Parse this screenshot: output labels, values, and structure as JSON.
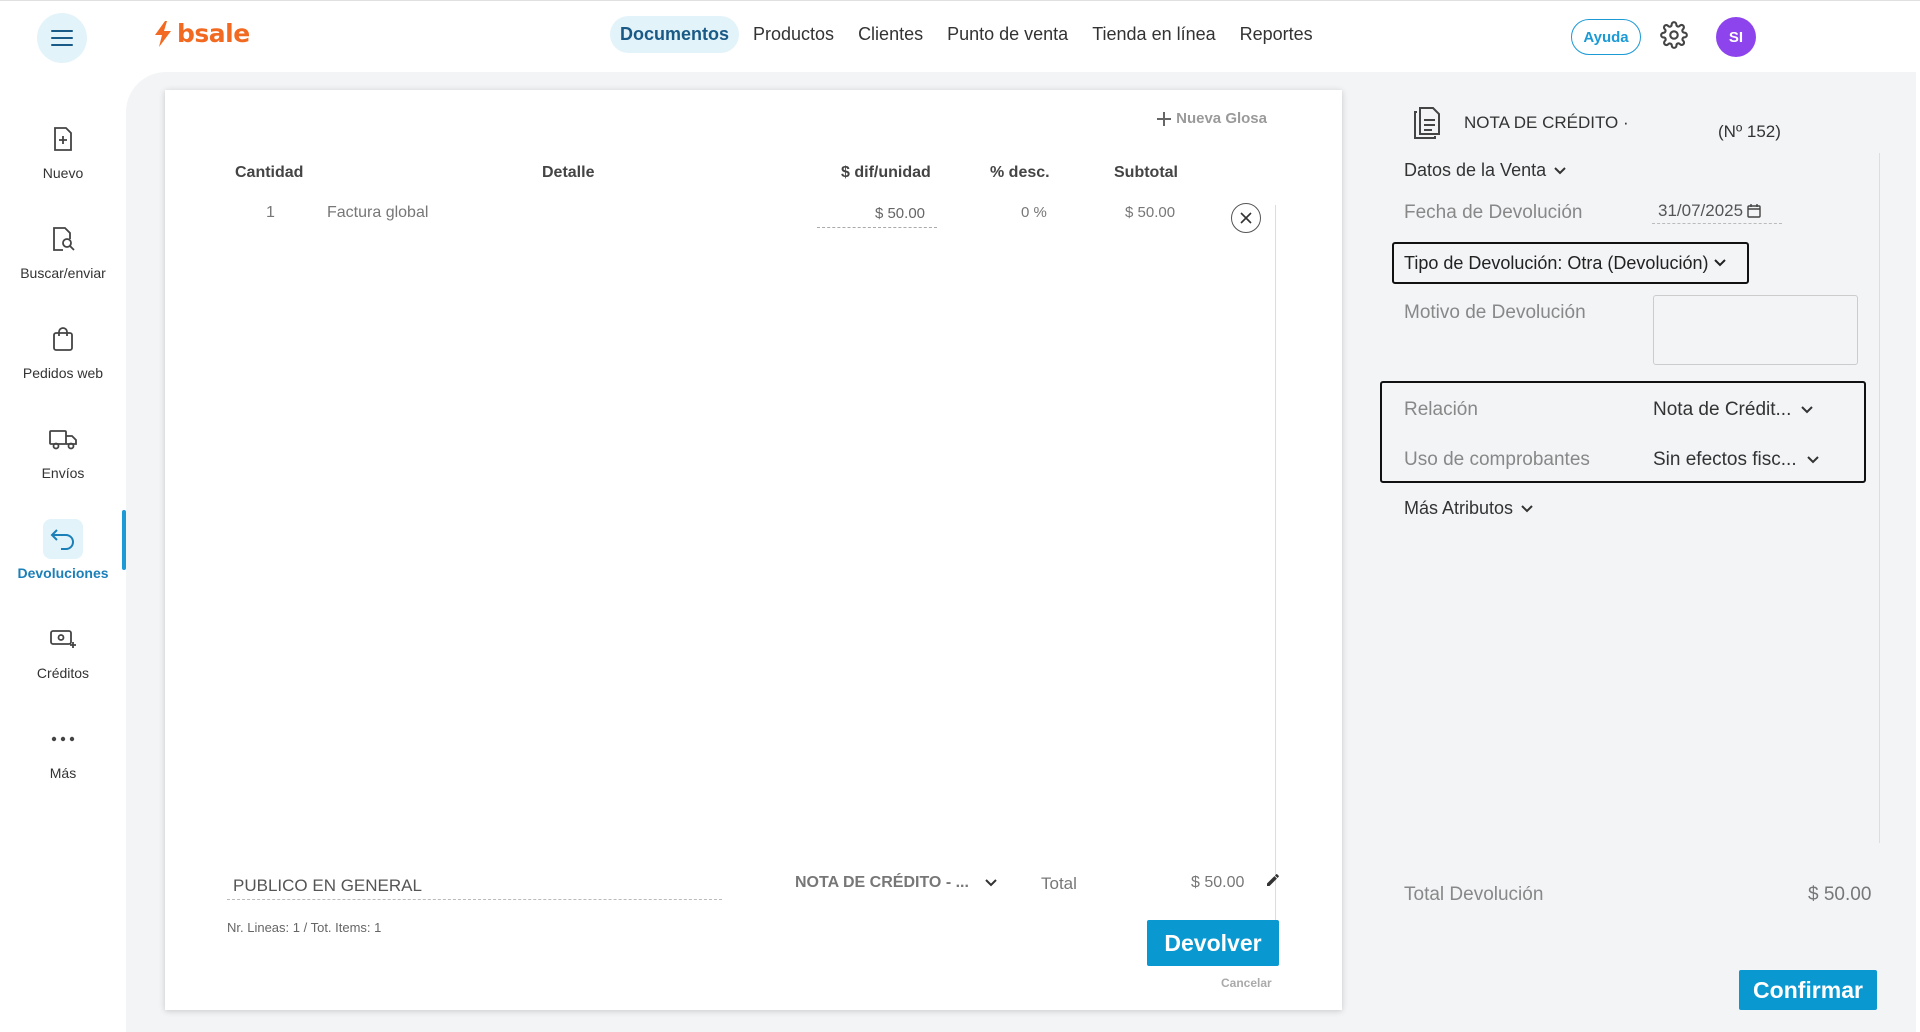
{
  "brand": {
    "name": "bsale",
    "color": "#f26a21"
  },
  "accent_color": "#0a98d1",
  "nav": [
    {
      "label": "Documentos",
      "active": true
    },
    {
      "label": "Productos"
    },
    {
      "label": "Clientes"
    },
    {
      "label": "Punto de venta"
    },
    {
      "label": "Tienda en línea"
    },
    {
      "label": "Reportes"
    }
  ],
  "header": {
    "help_label": "Ayuda",
    "avatar_initials": "SI"
  },
  "sidebar": {
    "items": [
      {
        "label": "Nuevo",
        "icon": "file-plus-icon"
      },
      {
        "label": "Buscar/enviar",
        "icon": "file-search-icon"
      },
      {
        "label": "Pedidos web",
        "icon": "shopping-bag-icon"
      },
      {
        "label": "Envíos",
        "icon": "truck-icon"
      },
      {
        "label": "Devoluciones",
        "icon": "return-arrow-icon",
        "active": true
      },
      {
        "label": "Créditos",
        "icon": "cash-plus-icon"
      },
      {
        "label": "Más",
        "icon": "more-dots-icon"
      }
    ]
  },
  "document": {
    "new_gloss_label": "Nueva Glosa",
    "columns": [
      "Cantidad",
      "Detalle",
      "$ dif/unidad",
      "% desc.",
      "Subtotal"
    ],
    "rows": [
      {
        "quantity": "1",
        "detail": "Factura global",
        "unit_price": "$ 50.00",
        "discount": "0 %",
        "subtotal": "$ 50.00"
      }
    ],
    "client": "PUBLICO EN GENERAL",
    "doc_type": "NOTA DE CRÉDITO - ...",
    "total_label": "Total",
    "total_value": "$ 50.00",
    "lines_info": "Nr. Lineas: 1 / Tot. Items: 1",
    "submit_label": "Devolver",
    "cancel_label": "Cancelar"
  },
  "panel": {
    "doc_title": "NOTA DE CRÉDITO ·",
    "doc_number": "(Nº 152)",
    "sale_data_label": "Datos de la Venta",
    "return_date_label": "Fecha de Devolución",
    "return_date_value": "31/07/2025",
    "return_type_label": "Tipo de Devolución: Otra (Devolución)",
    "reason_label": "Motivo de Devolución",
    "reason_value": "",
    "relation_label": "Relación",
    "relation_value": "Nota de Crédit...",
    "usage_label": "Uso de comprobantes",
    "usage_value": "Sin efectos fisc...",
    "more_attrs_label": "Más Atributos",
    "total_return_label": "Total Devolución",
    "total_return_value": "$ 50.00",
    "confirm_label": "Confirmar"
  }
}
